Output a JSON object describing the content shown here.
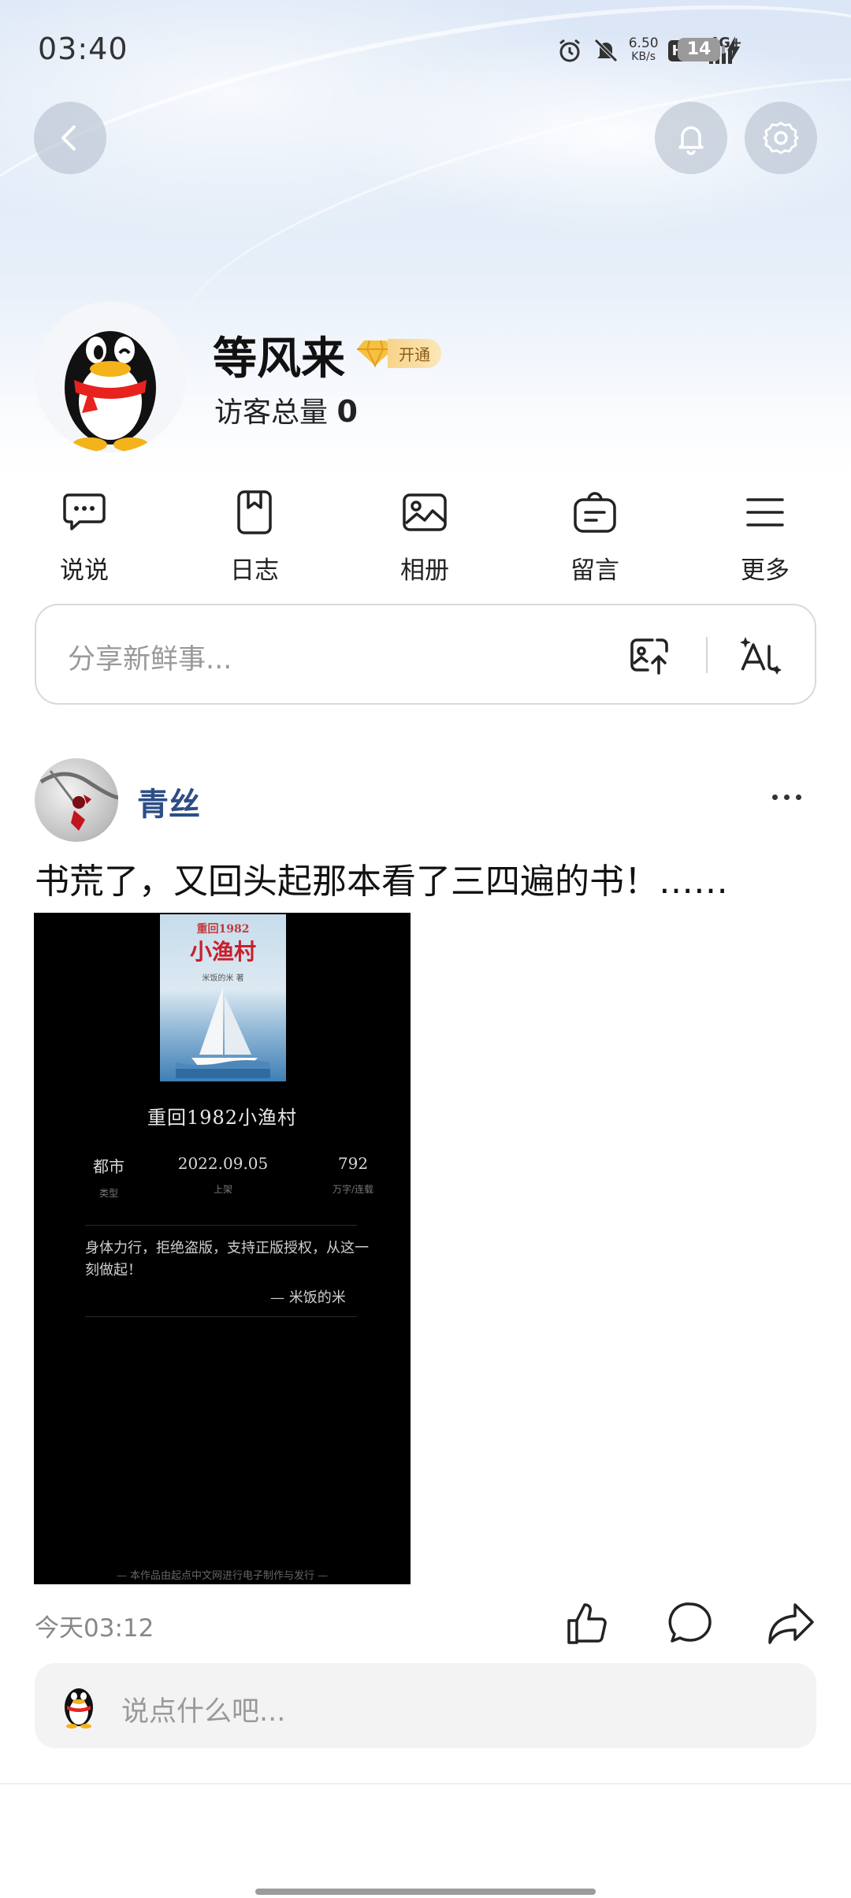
{
  "status_bar": {
    "time": "03:40",
    "net_speed_value": "6.50",
    "net_speed_unit": "KB/s",
    "hd_label": "HD",
    "network_label": "4G+",
    "battery_level": "14"
  },
  "header": {
    "back_icon": "chevron-left-icon",
    "bell_icon": "bell-icon",
    "settings_icon": "gear-icon"
  },
  "profile": {
    "username": "等风来",
    "vip_label": "开通",
    "visitors_label": "访客总量",
    "visitors_count": "0"
  },
  "quick_nav": [
    {
      "label": "说说",
      "icon": "chat-bubble-icon"
    },
    {
      "label": "日志",
      "icon": "bookmark-note-icon"
    },
    {
      "label": "相册",
      "icon": "image-icon"
    },
    {
      "label": "留言",
      "icon": "message-bag-icon"
    },
    {
      "label": "更多",
      "icon": "menu-icon"
    }
  ],
  "share": {
    "placeholder": "分享新鲜事...",
    "upload_icon": "photo-upload-icon",
    "ai_icon": "ai-sparkle-icon"
  },
  "post": {
    "author": "青丝",
    "text": "书荒了，又回头起那本看了三四遍的书！……",
    "time": "今天03:12",
    "book": {
      "cover_top": "重回1982",
      "cover_title": "小渔村",
      "cover_author": "米饭的米 著",
      "title": "重回1982小渔村",
      "stats": [
        {
          "value": "都市",
          "label": "类型"
        },
        {
          "value": "2022.09.05",
          "label": "上架"
        },
        {
          "value": "792",
          "label": "万字/连载"
        }
      ],
      "quote": "身体力行，拒绝盗版，支持正版授权，从这一刻做起！",
      "quote_by": "— 米饭的米",
      "footer": "— 本作品由起点中文网进行电子制作与发行 —"
    },
    "actions": {
      "like_icon": "thumbs-up-icon",
      "comment_icon": "comment-icon",
      "share_icon": "share-arrow-icon"
    }
  },
  "comment_box": {
    "placeholder": "说点什么吧..."
  },
  "colors": {
    "author_name": "#2e4d86",
    "vip_gold": "#f7d48a",
    "book_bg": "#000000"
  }
}
